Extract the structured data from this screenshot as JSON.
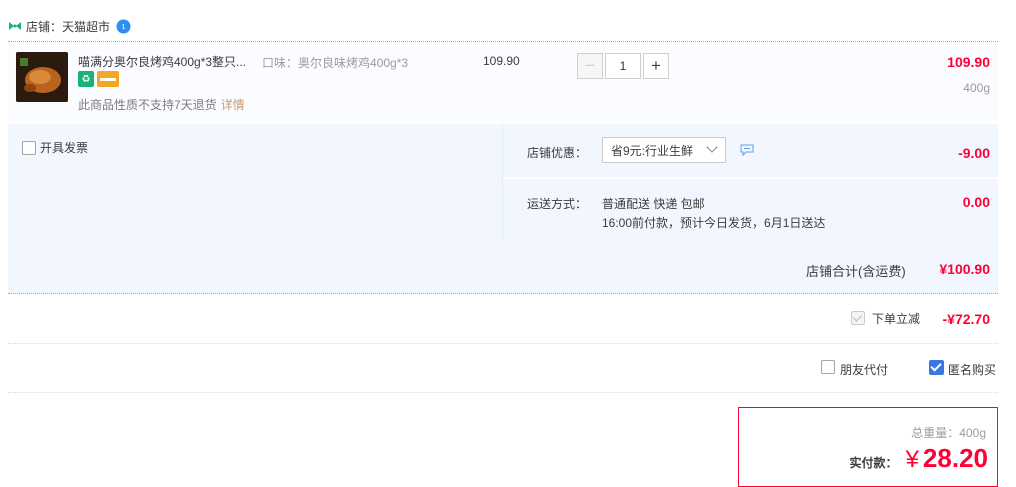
{
  "shop": {
    "label": "店铺：天猫超市"
  },
  "item": {
    "title": "喵满分奥尔良烤鸡400g*3整只...",
    "spec_label": "口味：",
    "spec_value": "奥尔良味烤鸡400g*3",
    "no_return": "此商品性质不支持7天退货",
    "detail_link": "详情",
    "unit_price": "109.90",
    "quantity": "1",
    "minus": "−",
    "plus": "+",
    "total": "109.90",
    "weight": "400g"
  },
  "invoice": {
    "label": "开具发票"
  },
  "coupon": {
    "label": "店铺优惠：",
    "selected": "省9元:行业生鲜",
    "amount": "-9.00"
  },
  "shipping": {
    "label": "运送方式：",
    "line1": "普通配送 快递 包邮",
    "line2": "16:00前付款，预计今日发货，6月1日送达",
    "amount": "0.00"
  },
  "subtotal": {
    "label": "店铺合计(含运费)",
    "amount": "¥100.90"
  },
  "discount": {
    "label": "下单立减",
    "amount": "-¥72.70"
  },
  "options": {
    "friend_pay": "朋友代付",
    "anonymous": "匿名购买"
  },
  "payment": {
    "weight_label": "总重量：",
    "weight_value": "400g",
    "pay_label": "实付款：",
    "currency": "¥",
    "amount": "28.20"
  },
  "colors": {
    "price_red": "#ff0036",
    "panel_bg": "#f2f7ff",
    "checkbox_blue": "#3a77e0",
    "tmall_green": "#1bb17a"
  }
}
